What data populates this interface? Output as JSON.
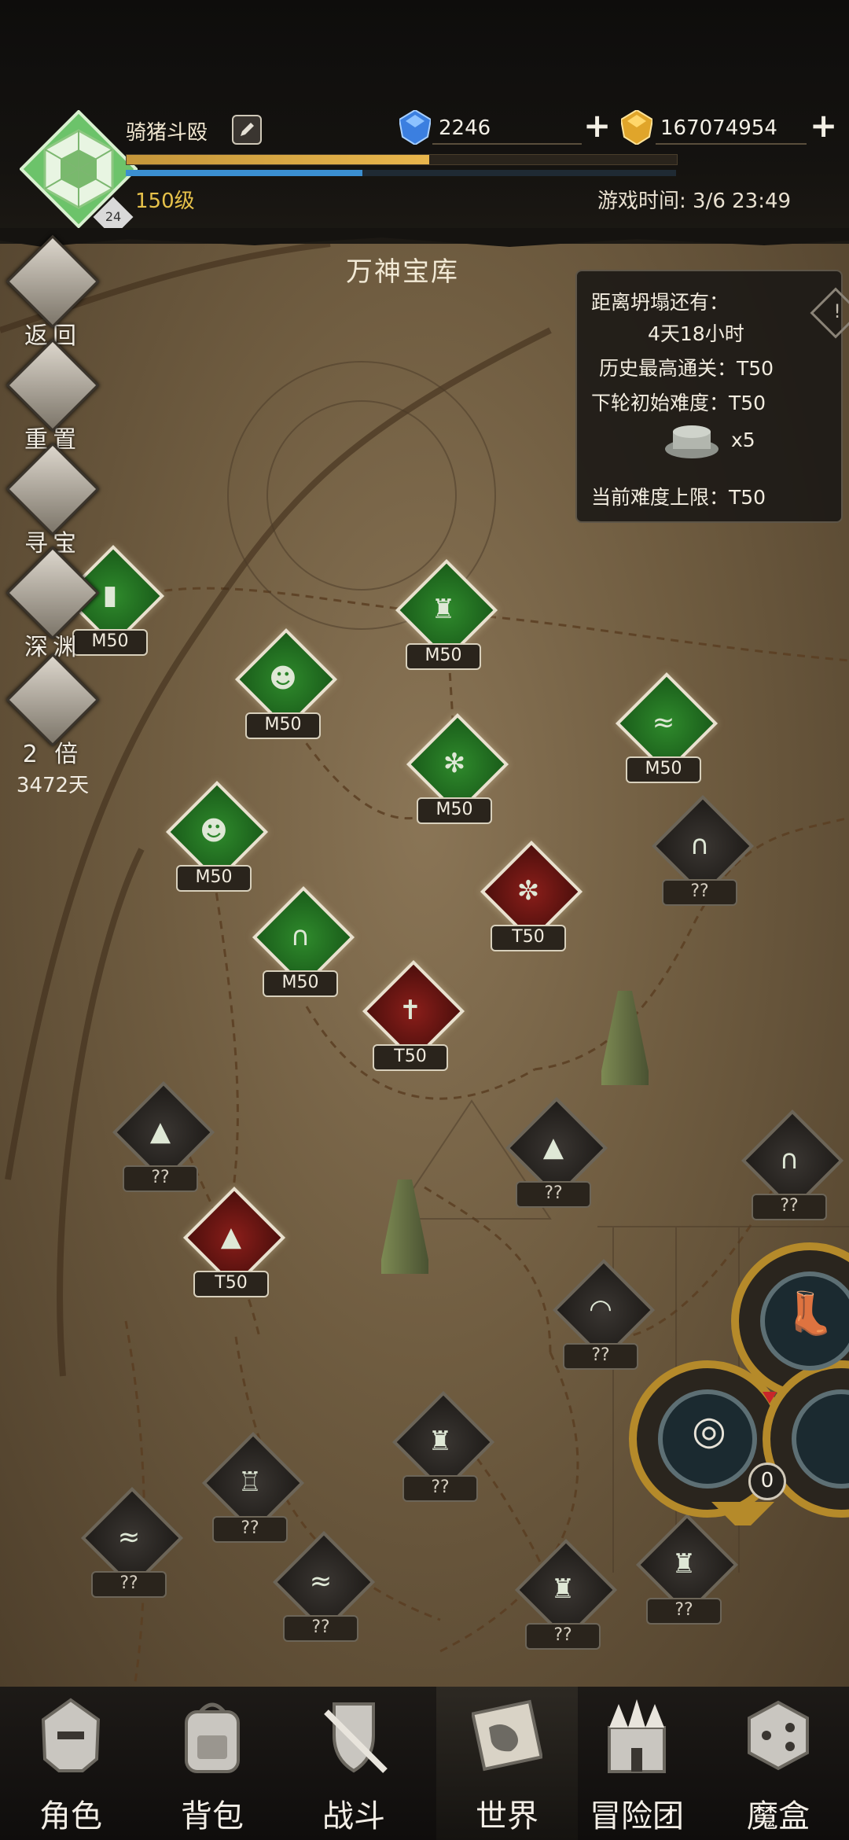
{
  "header": {
    "player_name": "骑猪斗殴",
    "level_text": "150级",
    "avatar_badge": "24",
    "xp_fraction": 0.55,
    "mp_fraction": 0.43,
    "gems": "2246",
    "gold": "167074954",
    "play_time": "游戏时间: 3/6 23:49"
  },
  "map": {
    "title": "万神宝库"
  },
  "side_menu": [
    {
      "label": "返回",
      "icon": "return-icon"
    },
    {
      "label": "重置",
      "icon": "reset-icon"
    },
    {
      "label": "寻宝",
      "icon": "skull-icon"
    },
    {
      "label": "深渊",
      "icon": "abyss-icon"
    },
    {
      "label": "2 倍",
      "icon": "up-arrow-icon",
      "sub": "3472天"
    }
  ],
  "info_panel": {
    "collapse_label": "距离坍塌还有：",
    "collapse_time": "4天18小时",
    "best_clear": "历史最高通关：T50",
    "next_difficulty": "下轮初始难度：T50",
    "reward_count": "x5",
    "difficulty_cap": "当前难度上限：T50"
  },
  "nodes": [
    {
      "label": "M50",
      "kind": "green",
      "sym": "▮"
    },
    {
      "label": "M50",
      "kind": "green",
      "sym": "♜"
    },
    {
      "label": "M50",
      "kind": "green",
      "sym": "☻"
    },
    {
      "label": "M50",
      "kind": "green",
      "sym": "≈"
    },
    {
      "label": "M50",
      "kind": "green",
      "sym": "✻"
    },
    {
      "label": "M50",
      "kind": "green",
      "sym": "☻"
    },
    {
      "label": "M50",
      "kind": "green",
      "sym": "∩"
    },
    {
      "label": "T50",
      "kind": "red",
      "sym": "✼"
    },
    {
      "label": "T50",
      "kind": "red",
      "sym": "✝"
    },
    {
      "label": "T50",
      "kind": "red",
      "sym": "▲"
    },
    {
      "label": "??",
      "kind": "dark",
      "sym": "∩"
    },
    {
      "label": "??",
      "kind": "dark",
      "sym": "▲"
    },
    {
      "label": "??",
      "kind": "dark",
      "sym": "▲"
    },
    {
      "label": "??",
      "kind": "dark",
      "sym": "∩"
    },
    {
      "label": "??",
      "kind": "dark",
      "sym": "◠"
    },
    {
      "label": "??",
      "kind": "dark",
      "sym": "♜"
    },
    {
      "label": "??",
      "kind": "dark",
      "sym": "♖"
    },
    {
      "label": "??",
      "kind": "dark",
      "sym": "≈"
    },
    {
      "label": "??",
      "kind": "dark",
      "sym": "≈"
    },
    {
      "label": "??",
      "kind": "dark",
      "sym": "♜"
    },
    {
      "label": "??",
      "kind": "dark",
      "sym": "♜"
    }
  ],
  "equipment": {
    "count": "0"
  },
  "bottom_nav": [
    {
      "label": "角色",
      "icon": "helmet-icon",
      "active": false
    },
    {
      "label": "背包",
      "icon": "backpack-icon",
      "active": false
    },
    {
      "label": "战斗",
      "icon": "sword-shield-icon",
      "active": false
    },
    {
      "label": "世界",
      "icon": "globe-map-icon",
      "active": true
    },
    {
      "label": "冒险团",
      "icon": "castle-icon",
      "active": false
    },
    {
      "label": "魔盒",
      "icon": "magic-box-icon",
      "active": false
    }
  ],
  "colors": {
    "gold": "#e7c24a",
    "green_node": "#2f8a2c",
    "red_node": "#8a1e1a",
    "mp_bar": "#3b8fd0"
  }
}
